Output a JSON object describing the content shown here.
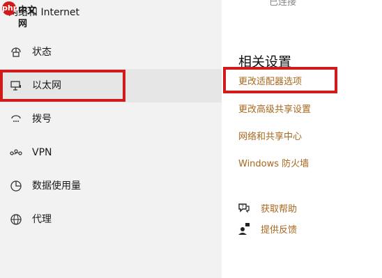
{
  "sidebar": {
    "header": "网络和 Internet",
    "watermark": "中文网",
    "watermark_badge": "php",
    "items": [
      {
        "label": "状态",
        "icon": "status-icon"
      },
      {
        "label": "以太网",
        "icon": "ethernet-icon"
      },
      {
        "label": "拨号",
        "icon": "dialup-icon"
      },
      {
        "label": "VPN",
        "icon": "vpn-icon"
      },
      {
        "label": "数据使用量",
        "icon": "data-usage-icon"
      },
      {
        "label": "代理",
        "icon": "proxy-icon"
      }
    ]
  },
  "main": {
    "top_text": "已连接",
    "related_title": "相关设置",
    "links": [
      "更改适配器选项",
      "更改高级共享设置",
      "网络和共享中心",
      "Windows 防火墙"
    ],
    "help": [
      {
        "label": "获取帮助",
        "icon": "help-icon"
      },
      {
        "label": "提供反馈",
        "icon": "feedback-icon"
      }
    ]
  },
  "colors": {
    "link": "#a8681f",
    "highlight_box": "#d11a1a",
    "sidebar_bg": "#f2f2f2"
  }
}
